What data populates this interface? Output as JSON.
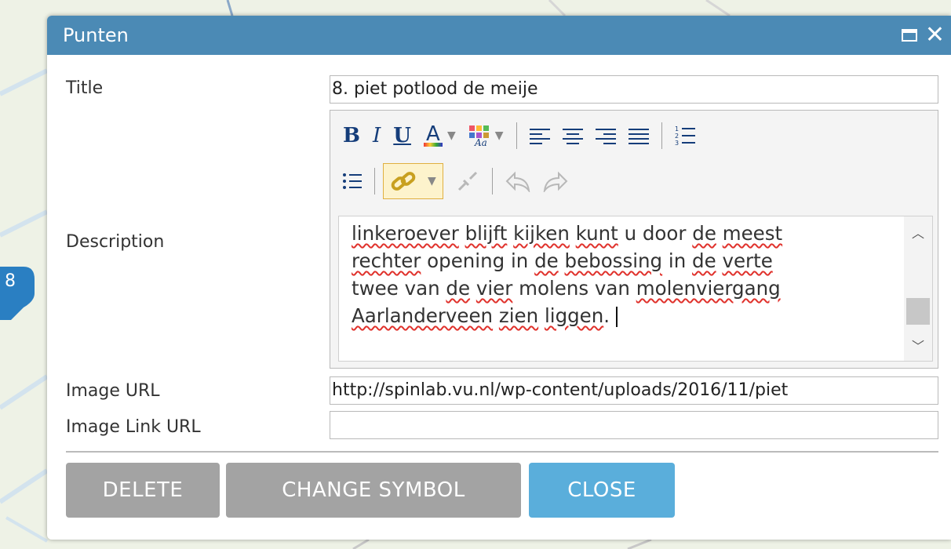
{
  "dialog": {
    "title": "Punten",
    "colors": {
      "titlebar": "#4b8ab5",
      "button_gray": "#a3a3a3",
      "button_blue": "#5aaedb"
    }
  },
  "form": {
    "title_label": "Title",
    "title_value": "8. piet potlood de meije",
    "description_label": "Description",
    "description_lines": [
      "linkeroever blijft kijken kunt u door de meest",
      "rechter opening in de bebossing in de verte",
      "twee van de vier molens van molenviergang",
      "Aarlanderveen zien liggen."
    ],
    "image_url_label": "Image URL",
    "image_url_value": "http://spinlab.vu.nl/wp-content/uploads/2016/11/piet",
    "image_link_url_label": "Image Link URL",
    "image_link_url_value": ""
  },
  "toolbar": {
    "items": [
      "bold-icon",
      "italic-icon",
      "underline-icon",
      "font-color-icon",
      "background-color-icon",
      "align-left-icon",
      "align-center-icon",
      "align-right-icon",
      "align-justify-icon",
      "ordered-list-icon",
      "unordered-list-icon",
      "link-icon",
      "unlink-icon",
      "undo-icon",
      "redo-icon"
    ]
  },
  "marker": {
    "label": "8"
  },
  "buttons": {
    "delete": "DELETE",
    "change_symbol": "CHANGE SYMBOL",
    "close": "CLOSE"
  }
}
